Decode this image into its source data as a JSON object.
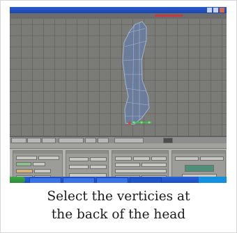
{
  "caption": {
    "line1": "Select the verticies at",
    "line2": "the back of the head"
  },
  "colors": {
    "viewport_bg": "#7b7b77",
    "mesh_fill": "#6a7ea0",
    "mesh_wire": "#9fb4d8",
    "selection": "#2fd04a",
    "buttons_bg": "#b4b4b0",
    "taskbar": "#1b4fc0"
  }
}
